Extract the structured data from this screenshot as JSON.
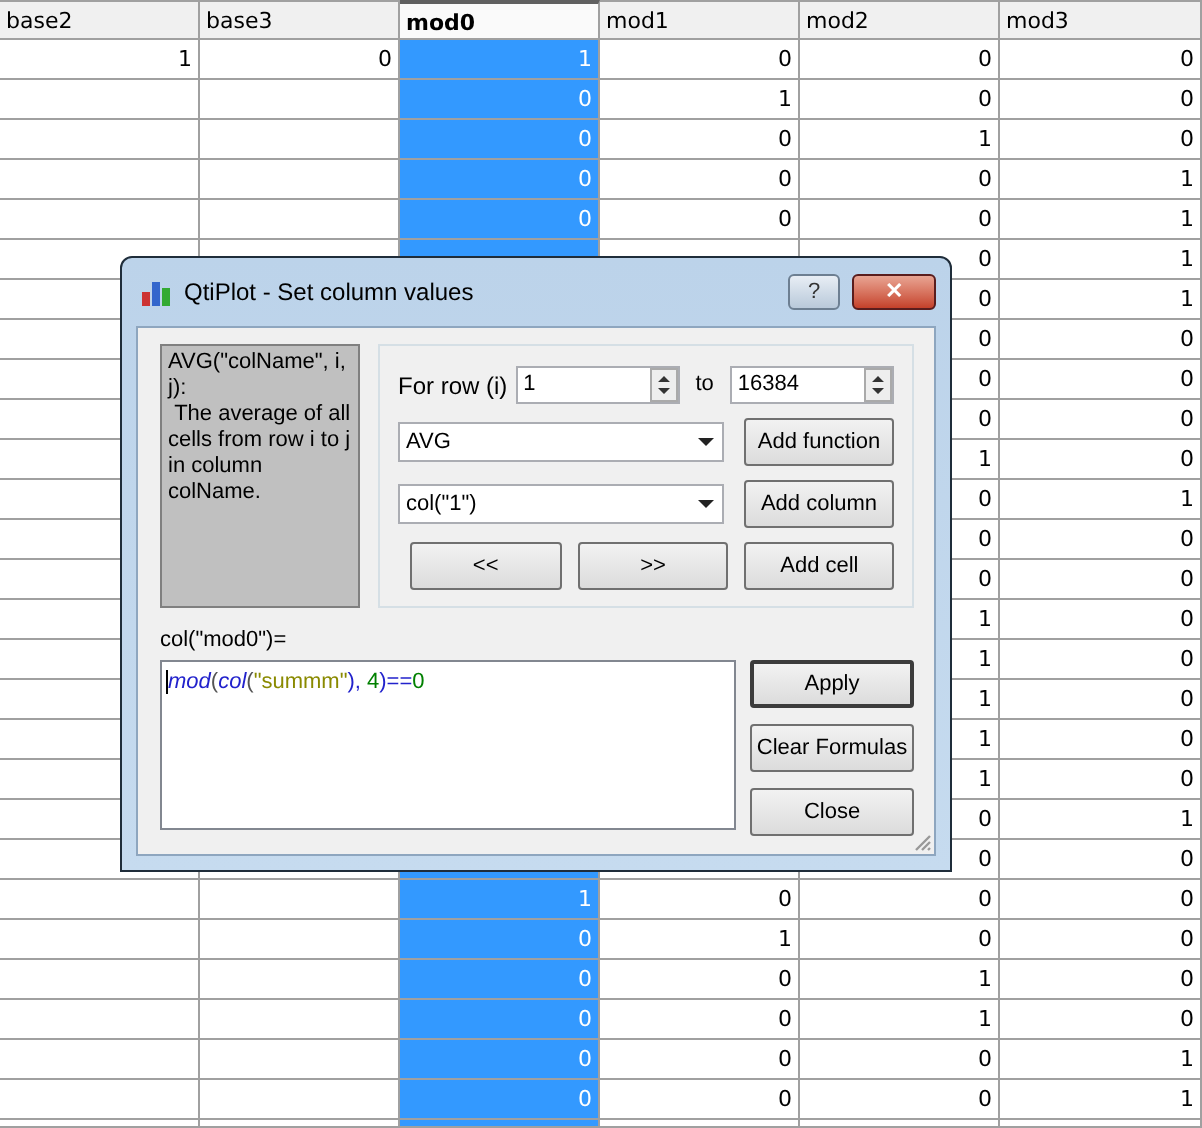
{
  "table": {
    "columns": [
      {
        "label": "base2",
        "selected": false
      },
      {
        "label": "base3",
        "selected": false
      },
      {
        "label": "mod0",
        "selected": true
      },
      {
        "label": "mod1",
        "selected": false
      },
      {
        "label": "mod2",
        "selected": false
      },
      {
        "label": "mod3",
        "selected": false
      }
    ],
    "rows": [
      {
        "cells": [
          "1",
          "0",
          "1",
          "0",
          "0",
          "0"
        ]
      },
      {
        "cells": [
          null,
          null,
          "0",
          "1",
          "0",
          "0"
        ]
      },
      {
        "cells": [
          null,
          null,
          "0",
          "0",
          "1",
          "0"
        ]
      },
      {
        "cells": [
          null,
          null,
          "0",
          "0",
          "0",
          "1"
        ]
      },
      {
        "cells": [
          null,
          null,
          "0",
          "0",
          "0",
          "1"
        ]
      },
      {
        "cells": [
          null,
          null,
          null,
          null,
          "0",
          "1"
        ]
      },
      {
        "cells": [
          null,
          null,
          null,
          null,
          "0",
          "1"
        ]
      },
      {
        "cells": [
          null,
          null,
          null,
          null,
          "0",
          "0"
        ]
      },
      {
        "cells": [
          null,
          null,
          null,
          null,
          "0",
          "0"
        ]
      },
      {
        "cells": [
          null,
          null,
          null,
          null,
          "0",
          "0"
        ]
      },
      {
        "cells": [
          null,
          null,
          null,
          null,
          "1",
          "0"
        ]
      },
      {
        "cells": [
          null,
          null,
          null,
          null,
          "0",
          "1"
        ]
      },
      {
        "cells": [
          null,
          null,
          null,
          null,
          "0",
          "0"
        ]
      },
      {
        "cells": [
          null,
          null,
          null,
          null,
          "0",
          "0"
        ]
      },
      {
        "cells": [
          null,
          null,
          null,
          null,
          "1",
          "0"
        ]
      },
      {
        "cells": [
          null,
          null,
          null,
          null,
          "1",
          "0"
        ]
      },
      {
        "cells": [
          null,
          null,
          null,
          null,
          "1",
          "0"
        ]
      },
      {
        "cells": [
          null,
          null,
          null,
          null,
          "1",
          "0"
        ]
      },
      {
        "cells": [
          null,
          null,
          null,
          null,
          "1",
          "0"
        ]
      },
      {
        "cells": [
          null,
          null,
          null,
          null,
          "0",
          "1"
        ]
      },
      {
        "cells": [
          null,
          null,
          null,
          null,
          "0",
          "0"
        ]
      },
      {
        "cells": [
          null,
          null,
          "1",
          "0",
          "0",
          "0"
        ]
      },
      {
        "cells": [
          null,
          null,
          "0",
          "1",
          "0",
          "0"
        ]
      },
      {
        "cells": [
          null,
          null,
          "0",
          "0",
          "1",
          "0"
        ]
      },
      {
        "cells": [
          null,
          null,
          "0",
          "0",
          "1",
          "0"
        ]
      },
      {
        "cells": [
          null,
          null,
          "0",
          "0",
          "0",
          "1"
        ]
      },
      {
        "cells": [
          null,
          null,
          "0",
          "0",
          "0",
          "1"
        ]
      },
      {
        "cells": [
          null,
          null,
          null,
          null,
          null,
          null
        ]
      }
    ]
  },
  "dialog": {
    "title": "QtiPlot - Set column values",
    "help": "?",
    "close": "✕",
    "description": "AVG(\"colName\", i, j):\n The average of all cells from row i to j in column colName.",
    "for_row_label": "For row (i)",
    "from": "1",
    "to_label": "to",
    "to": "16384",
    "function": "AVG",
    "add_function": "Add function",
    "column": "col(\"1\")",
    "add_column": "Add column",
    "prev": "<<",
    "next": ">>",
    "add_cell": "Add cell",
    "formula_label": "col(\"mod0\")=",
    "formula": [
      {
        "kind": "function",
        "text": "mod"
      },
      {
        "kind": "plain",
        "text": "("
      },
      {
        "kind": "function",
        "text": "col"
      },
      {
        "kind": "plain",
        "text": "("
      },
      {
        "kind": "string",
        "text": "\"summm\""
      },
      {
        "kind": "operator",
        "text": "), "
      },
      {
        "kind": "number",
        "text": "4"
      },
      {
        "kind": "operator",
        "text": ")=="
      },
      {
        "kind": "number",
        "text": "0"
      }
    ],
    "buttons": [
      {
        "label": "Apply",
        "default": true
      },
      {
        "label": "Clear Formulas",
        "default": false
      },
      {
        "label": "Close",
        "default": false
      }
    ]
  }
}
